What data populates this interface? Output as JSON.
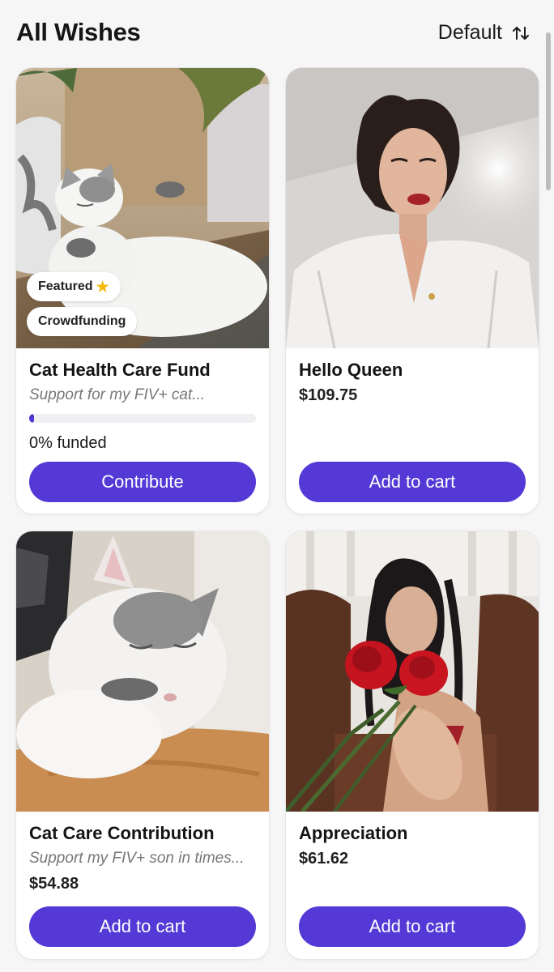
{
  "header": {
    "title": "All Wishes",
    "sort_label": "Default",
    "sort_icon": "sort-arrows-icon"
  },
  "cards": [
    {
      "title": "Cat Health Care Fund",
      "description": "Support for my FIV+ cat...",
      "badges": [
        "Featured",
        "Crowdfunding"
      ],
      "badge_icon": "star-icon",
      "progress_fraction": 0,
      "funded_text": "0% funded",
      "button": "Contribute",
      "image": "cat-lying-photo"
    },
    {
      "title": "Hello Queen",
      "price": "$109.75",
      "button": "Add to cart",
      "image": "woman-selfie-photo"
    },
    {
      "title": "Cat Care Contribution",
      "description": "Support my FIV+ son in times...",
      "price": "$54.88",
      "button": "Add to cart",
      "image": "cat-sleeping-photo"
    },
    {
      "title": "Appreciation",
      "price": "$61.62",
      "button": "Add to cart",
      "image": "roses-photo"
    }
  ],
  "colors": {
    "accent": "#5439d6",
    "background": "#f6f6f7"
  }
}
